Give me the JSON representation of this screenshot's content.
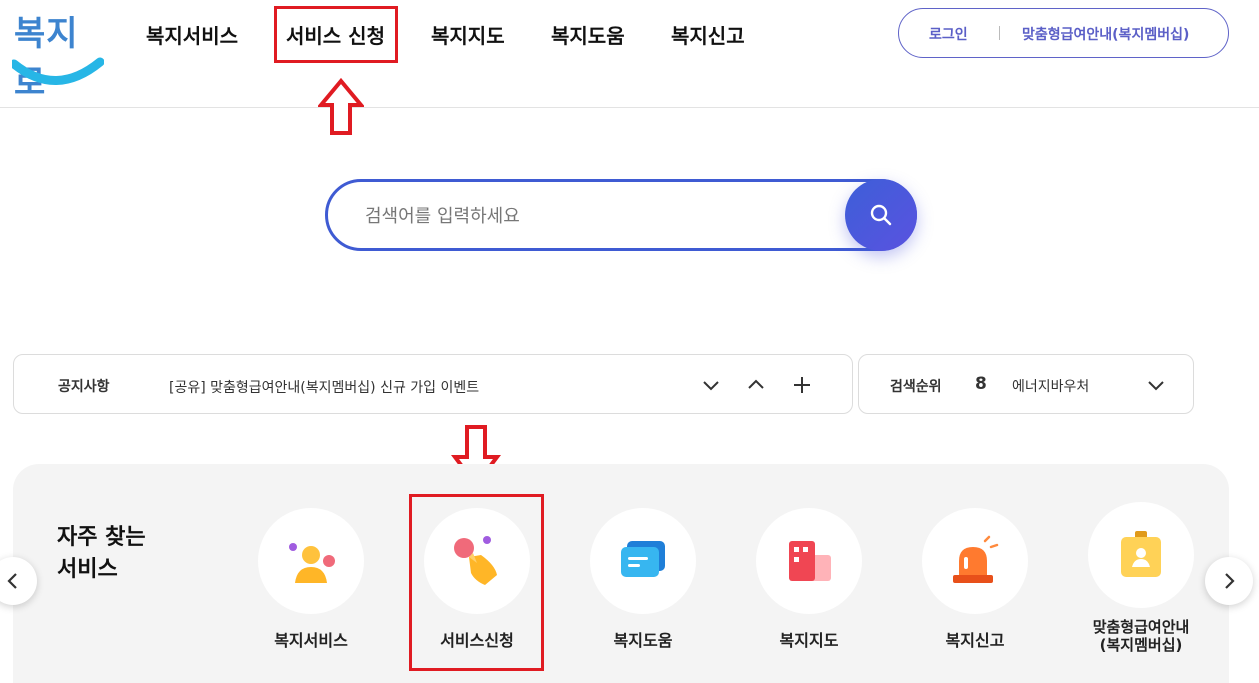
{
  "logo": {
    "text": "복지로"
  },
  "nav": {
    "items": [
      "복지서비스",
      "서비스 신청",
      "복지지도",
      "복지도움",
      "복지신고"
    ]
  },
  "user_menu": {
    "login": "로그인",
    "membership": "맞춤형급여안내(복지멤버십)"
  },
  "search": {
    "placeholder": "검색어를 입력하세요"
  },
  "notice": {
    "label": "공지사항",
    "text": "[공유] 맞춤형급여안내(복지멤버십) 신규 가입 이벤트"
  },
  "rank": {
    "label": "검색순위",
    "number": "8",
    "text": "에너지바우처"
  },
  "services": {
    "title": "자주 찾는\n서비스",
    "items": [
      {
        "label": "복지서비스",
        "icon": "people-icon"
      },
      {
        "label": "서비스신청",
        "icon": "hand-tap-icon"
      },
      {
        "label": "복지도움",
        "icon": "chat-bubble-icon"
      },
      {
        "label": "복지지도",
        "icon": "building-icon"
      },
      {
        "label": "복지신고",
        "icon": "siren-icon"
      },
      {
        "label": "맞춤형급여안내\n(복지멤버십)",
        "icon": "id-badge-icon"
      }
    ]
  },
  "colors": {
    "accent": "#3f5bd3",
    "highlight": "#e01b22",
    "membership_text": "#5b5fc7"
  }
}
